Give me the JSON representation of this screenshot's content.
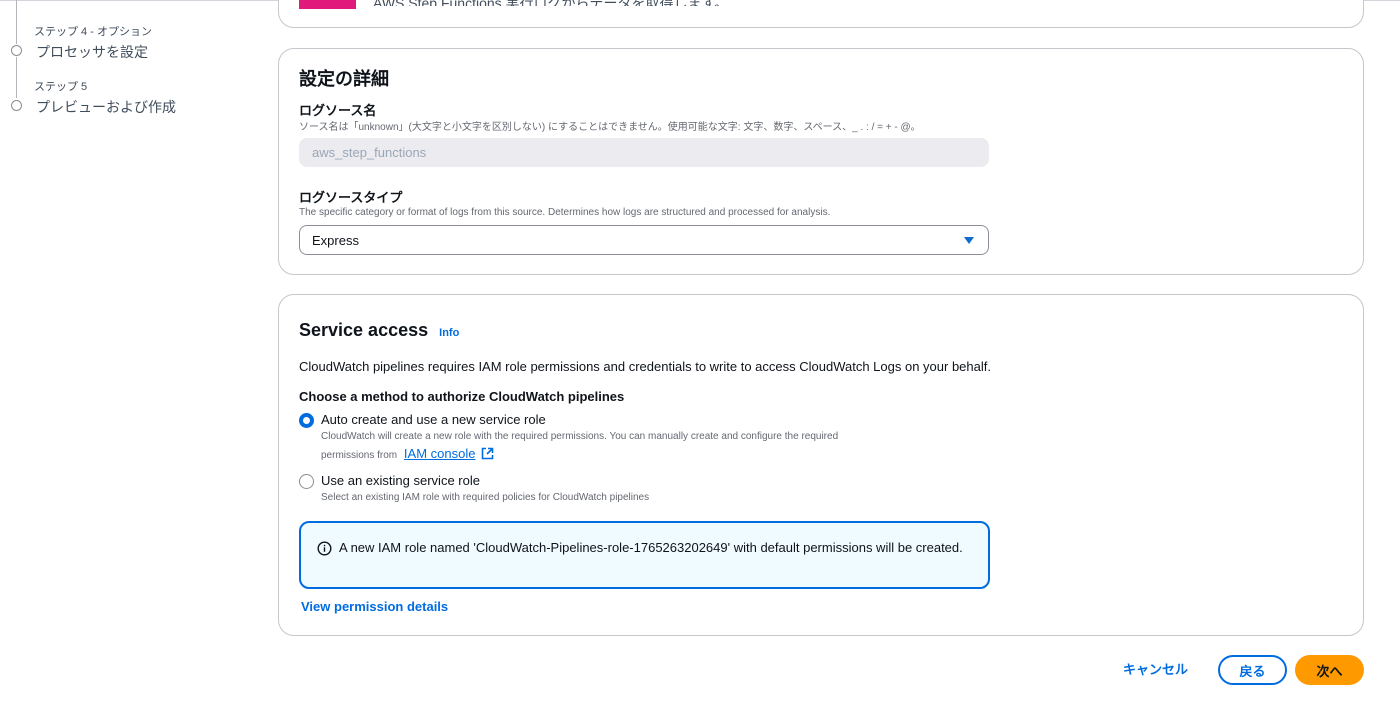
{
  "steps": [
    {
      "label": "ステップ 4 - オプション",
      "title": "プロセッサを設定"
    },
    {
      "label": "ステップ 5",
      "title": "プレビューおよび作成"
    }
  ],
  "top_card": {
    "cut_text": "AWS Step Functions 実行ログからデータを取得します。",
    "accent_color": "#e0197b"
  },
  "details": {
    "heading": "設定の詳細",
    "source_name": {
      "label": "ログソース名",
      "description": "ソース名は「unknown」(大文字と小文字を区別しない) にすることはできません。使用可能な文字: 文字、数字、スペース、_ . : / = + - @。",
      "value": "aws_step_functions"
    },
    "source_type": {
      "label": "ログソースタイプ",
      "description": "The specific category or format of logs from this source. Determines how logs are structured and processed for analysis.",
      "selected": "Express"
    }
  },
  "service_access": {
    "heading": "Service access",
    "info_label": "Info",
    "intro": "CloudWatch pipelines requires IAM role permissions and credentials to write to access CloudWatch Logs on your behalf.",
    "method_label": "Choose a method to authorize CloudWatch pipelines",
    "options": [
      {
        "label": "Auto create and use a new service role",
        "desc_line1": "CloudWatch will create a new role with the required permissions. You can manually create and configure the required",
        "desc_line2_prefix": "permissions from",
        "link": "IAM console",
        "checked": true
      },
      {
        "label": "Use an existing service role",
        "desc_line1": "Select an existing IAM role with required policies for CloudWatch pipelines",
        "checked": false
      }
    ],
    "alert_text": "A new IAM role named 'CloudWatch-Pipelines-role-1765263202649' with default permissions will be created.",
    "view_permissions": "View permission details"
  },
  "footer": {
    "cancel": "キャンセル",
    "back": "戻る",
    "next": "次へ"
  },
  "colors": {
    "primary": "#006ce0",
    "next_button": "#ff9900",
    "alert_bg": "#f0fbff"
  }
}
